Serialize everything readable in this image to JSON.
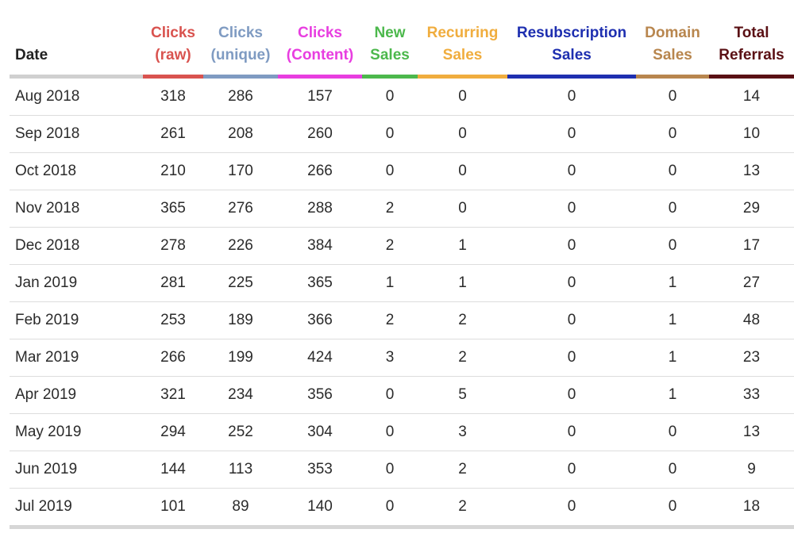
{
  "table": {
    "columns": [
      {
        "key": "date",
        "label": "Date",
        "color": "#222222",
        "underline": "#d0d0d0"
      },
      {
        "key": "clicks_raw",
        "label": "Clicks (raw)",
        "color": "#d9534f",
        "underline": "#d9534f"
      },
      {
        "key": "clicks_unique",
        "label": "Clicks (unique)",
        "color": "#7f9bc2",
        "underline": "#7f9bc2"
      },
      {
        "key": "clicks_content",
        "label": "Clicks (Content)",
        "color": "#e83ee0",
        "underline": "#e83ee0"
      },
      {
        "key": "new_sales",
        "label": "New Sales",
        "color": "#4cb84c",
        "underline": "#4cb84c"
      },
      {
        "key": "recurring_sales",
        "label": "Recurring Sales",
        "color": "#f0ad3e",
        "underline": "#f0ad3e"
      },
      {
        "key": "resubscription_sales",
        "label": "Resubscription Sales",
        "color": "#1e2fb0",
        "underline": "#1e2fb0"
      },
      {
        "key": "domain_sales",
        "label": "Domain Sales",
        "color": "#b8864e",
        "underline": "#b8864e"
      },
      {
        "key": "total_referrals",
        "label": "Total Referrals",
        "color": "#5a1014",
        "underline": "#5a1014"
      }
    ],
    "rows": [
      [
        "Aug 2018",
        "318",
        "286",
        "157",
        "0",
        "0",
        "0",
        "0",
        "14"
      ],
      [
        "Sep 2018",
        "261",
        "208",
        "260",
        "0",
        "0",
        "0",
        "0",
        "10"
      ],
      [
        "Oct 2018",
        "210",
        "170",
        "266",
        "0",
        "0",
        "0",
        "0",
        "13"
      ],
      [
        "Nov 2018",
        "365",
        "276",
        "288",
        "2",
        "0",
        "0",
        "0",
        "29"
      ],
      [
        "Dec 2018",
        "278",
        "226",
        "384",
        "2",
        "1",
        "0",
        "0",
        "17"
      ],
      [
        "Jan 2019",
        "281",
        "225",
        "365",
        "1",
        "1",
        "0",
        "1",
        "27"
      ],
      [
        "Feb 2019",
        "253",
        "189",
        "366",
        "2",
        "2",
        "0",
        "1",
        "48"
      ],
      [
        "Mar 2019",
        "266",
        "199",
        "424",
        "3",
        "2",
        "0",
        "1",
        "23"
      ],
      [
        "Apr 2019",
        "321",
        "234",
        "356",
        "0",
        "5",
        "0",
        "1",
        "33"
      ],
      [
        "May 2019",
        "294",
        "252",
        "304",
        "0",
        "3",
        "0",
        "0",
        "13"
      ],
      [
        "Jun 2019",
        "144",
        "113",
        "353",
        "0",
        "2",
        "0",
        "0",
        "9"
      ],
      [
        "Jul 2019",
        "101",
        "89",
        "140",
        "0",
        "2",
        "0",
        "0",
        "18"
      ]
    ]
  }
}
